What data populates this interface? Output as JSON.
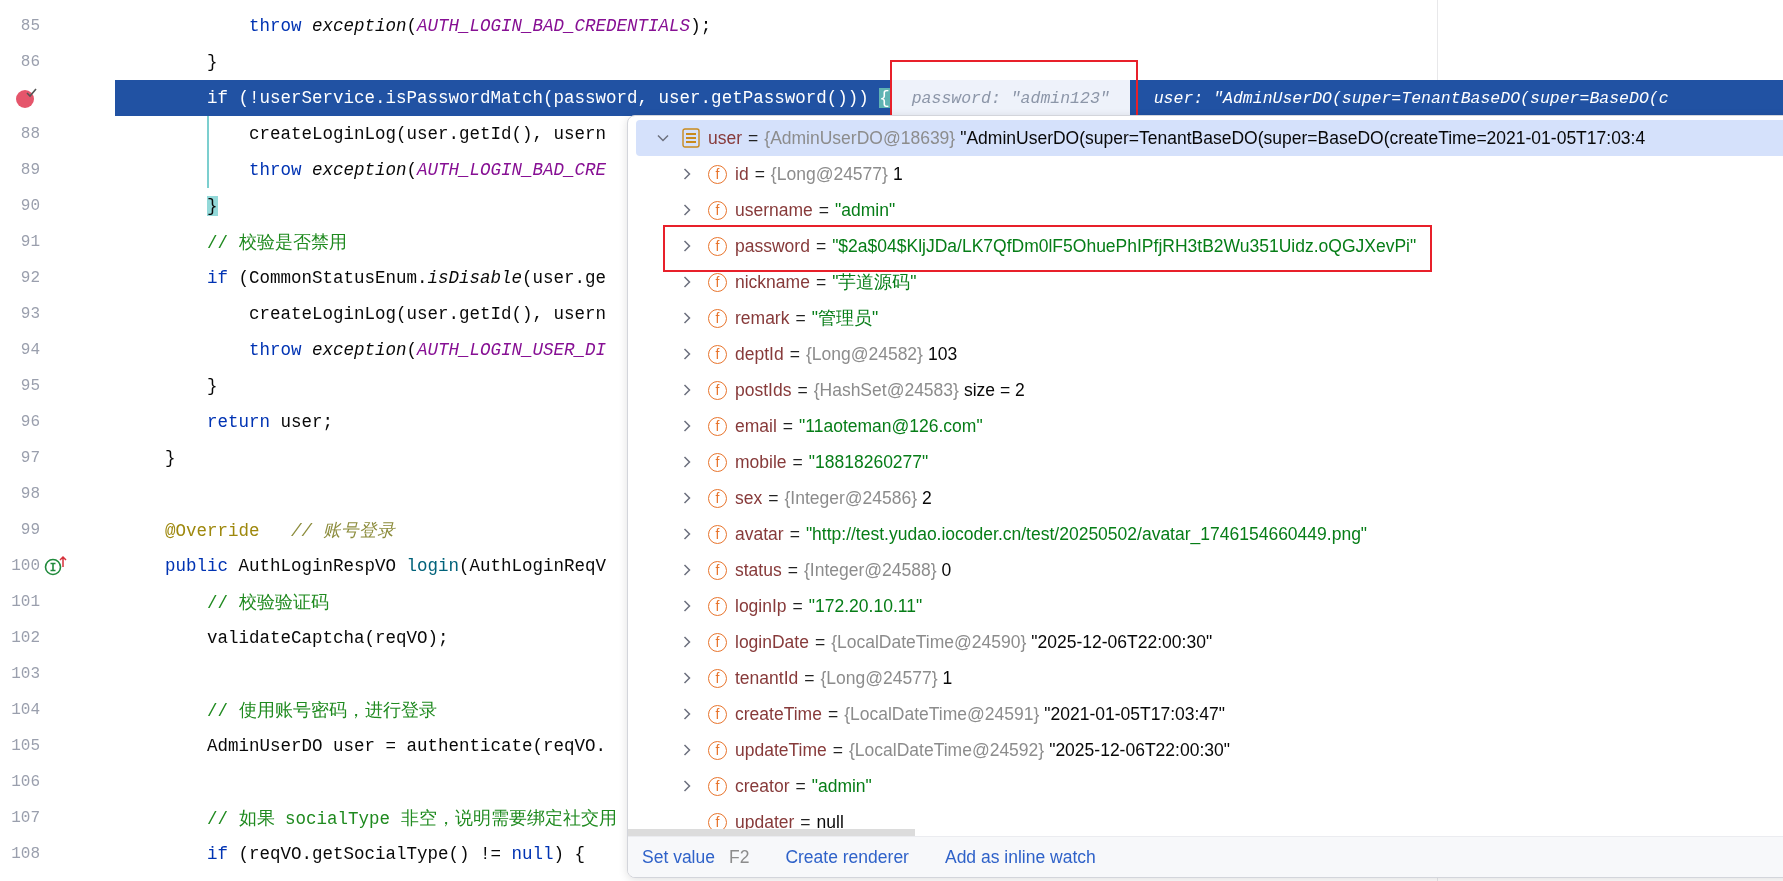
{
  "code_lines": [
    {
      "number": "85",
      "segments": [
        {
          "kind": "kw",
          "text": "            throw "
        },
        {
          "kind": "call",
          "text": "exception"
        },
        {
          "kind": "plain",
          "text": "("
        },
        {
          "kind": "const",
          "text": "AUTH_LOGIN_BAD_CREDENTIALS"
        },
        {
          "kind": "plain",
          "text": ");"
        }
      ]
    },
    {
      "number": "86",
      "segments": [
        {
          "kind": "plain",
          "text": "        }"
        }
      ]
    },
    {
      "gutter_icon": {
        "kind": "breakpoint"
      },
      "current": true,
      "segments": [
        {
          "kind": "kw",
          "text": "        if"
        },
        {
          "kind": "plain",
          "text": " (!userService.isPasswordMatch(password, user.getPassword())) "
        },
        {
          "kind": "match",
          "text": "{"
        }
      ],
      "hints": [
        {
          "kind": "param",
          "text": "password: \"admin123\"",
          "boxed": true
        },
        {
          "kind": "value",
          "text": "user: \"AdminUserDO(super=TenantBaseDO(super=BaseDO(c",
          "boxed": false
        }
      ]
    },
    {
      "number": "88",
      "guide": true,
      "segments": [
        {
          "kind": "plain",
          "text": "            createLoginLog(user.getId(), usern"
        }
      ]
    },
    {
      "number": "89",
      "guide": true,
      "segments": [
        {
          "kind": "kw",
          "text": "            throw "
        },
        {
          "kind": "call",
          "text": "exception"
        },
        {
          "kind": "plain",
          "text": "("
        },
        {
          "kind": "const",
          "text": "AUTH_LOGIN_BAD_CRE"
        }
      ]
    },
    {
      "number": "90",
      "segments": [
        {
          "kind": "match",
          "text": "        }"
        }
      ]
    },
    {
      "number": "91",
      "segments": [
        {
          "kind": "comment",
          "text": "        // 校验是否禁用"
        }
      ]
    },
    {
      "number": "92",
      "segments": [
        {
          "kind": "kw",
          "text": "        if"
        },
        {
          "kind": "plain",
          "text": " (CommonStatusEnum."
        },
        {
          "kind": "call",
          "text": "isDisable"
        },
        {
          "kind": "plain",
          "text": "(user.ge"
        }
      ]
    },
    {
      "number": "93",
      "segments": [
        {
          "kind": "plain",
          "text": "            createLoginLog(user.getId(), usern"
        }
      ]
    },
    {
      "number": "94",
      "segments": [
        {
          "kind": "kw",
          "text": "            throw "
        },
        {
          "kind": "call",
          "text": "exception"
        },
        {
          "kind": "plain",
          "text": "("
        },
        {
          "kind": "const",
          "text": "AUTH_LOGIN_USER_DI"
        }
      ]
    },
    {
      "number": "95",
      "segments": [
        {
          "kind": "plain",
          "text": "        }"
        }
      ]
    },
    {
      "number": "96",
      "segments": [
        {
          "kind": "kw",
          "text": "        return"
        },
        {
          "kind": "plain",
          "text": " user;"
        }
      ]
    },
    {
      "number": "97",
      "segments": [
        {
          "kind": "plain",
          "text": "    }"
        }
      ]
    },
    {
      "number": "98"
    },
    {
      "number": "99",
      "segments": [
        {
          "kind": "annot",
          "text": "    @Override   "
        },
        {
          "kind": "comment_italic",
          "text": "// 账号登录"
        }
      ]
    },
    {
      "number": "100",
      "gutter_icon": {
        "kind": "implements"
      },
      "segments": [
        {
          "kind": "kw",
          "text": "    public"
        },
        {
          "kind": "plain",
          "text": " AuthLoginRespVO "
        },
        {
          "kind": "decl",
          "text": "login"
        },
        {
          "kind": "plain",
          "text": "(AuthLoginReqV"
        }
      ]
    },
    {
      "number": "101",
      "segments": [
        {
          "kind": "comment",
          "text": "        // 校验验证码"
        }
      ]
    },
    {
      "number": "102",
      "segments": [
        {
          "kind": "plain",
          "text": "        validateCaptcha(reqVO);"
        }
      ]
    },
    {
      "number": "103"
    },
    {
      "number": "104",
      "segments": [
        {
          "kind": "comment",
          "text": "        // 使用账号密码，进行登录"
        }
      ]
    },
    {
      "number": "105",
      "segments": [
        {
          "kind": "plain",
          "text": "        AdminUserDO user = authenticate(reqVO."
        }
      ]
    },
    {
      "number": "106"
    },
    {
      "number": "107",
      "segments": [
        {
          "kind": "comment",
          "text": "        // 如果 socialType 非空，说明需要绑定社交用"
        }
      ]
    },
    {
      "number": "108",
      "segments": [
        {
          "kind": "kw",
          "text": "        if"
        },
        {
          "kind": "plain",
          "text": " (reqVO.getSocialType() != "
        },
        {
          "kind": "kw",
          "text": "null"
        },
        {
          "kind": "plain",
          "text": ") {"
        }
      ]
    }
  ],
  "debug_popup": {
    "root": {
      "name": "user",
      "sep": "=",
      "type": "{AdminUserDO@18639}",
      "value": {
        "kind": "plain",
        "text": "\"AdminUserDO(super=TenantBaseDO(super=BaseDO(createTime=2021-01-05T17:03:4"
      },
      "expanded": true,
      "selected": true,
      "children": [
        {
          "icon": "f",
          "name": "id",
          "sep": "=",
          "type": "{Long@24577}",
          "value": {
            "kind": "plain",
            "text": "1"
          },
          "expandable": true,
          "boxed": false
        },
        {
          "icon": "f",
          "name": "username",
          "sep": "=",
          "value": {
            "kind": "string",
            "text": "\"admin\""
          },
          "expandable": true,
          "boxed": false
        },
        {
          "icon": "f",
          "name": "password",
          "sep": "=",
          "value": {
            "kind": "string",
            "text": "\"$2a$04$KljJDa/LK7QfDm0lF5OhuePhIPfjRH3tB2Wu351Uidz.oQGJXevPi\""
          },
          "expandable": true,
          "boxed": true
        },
        {
          "icon": "f",
          "name": "nickname",
          "sep": "=",
          "value": {
            "kind": "string",
            "text": "\"芋道源码\""
          },
          "expandable": true,
          "boxed": false
        },
        {
          "icon": "f",
          "name": "remark",
          "sep": "=",
          "value": {
            "kind": "string",
            "text": "\"管理员\""
          },
          "expandable": true,
          "boxed": false
        },
        {
          "icon": "f",
          "name": "deptId",
          "sep": "=",
          "type": "{Long@24582}",
          "value": {
            "kind": "plain",
            "text": "103"
          },
          "expandable": true,
          "boxed": false
        },
        {
          "icon": "f",
          "name": "postIds",
          "sep": "=",
          "type": "{HashSet@24583}",
          "value": {
            "kind": "plain",
            "text": "size = 2"
          },
          "expandable": true,
          "boxed": false
        },
        {
          "icon": "f",
          "name": "email",
          "sep": "=",
          "value": {
            "kind": "string",
            "text": "\"11aoteman@126.com\""
          },
          "expandable": true,
          "boxed": false
        },
        {
          "icon": "f",
          "name": "mobile",
          "sep": "=",
          "value": {
            "kind": "string",
            "text": "\"18818260277\""
          },
          "expandable": true,
          "boxed": false
        },
        {
          "icon": "f",
          "name": "sex",
          "sep": "=",
          "type": "{Integer@24586}",
          "value": {
            "kind": "plain",
            "text": "2"
          },
          "expandable": true,
          "boxed": false
        },
        {
          "icon": "f",
          "name": "avatar",
          "sep": "=",
          "value": {
            "kind": "string",
            "text": "\"http://test.yudao.iocoder.cn/test/20250502/avatar_1746154660449.png\""
          },
          "expandable": true,
          "boxed": false
        },
        {
          "icon": "f",
          "name": "status",
          "sep": "=",
          "type": "{Integer@24588}",
          "value": {
            "kind": "plain",
            "text": "0"
          },
          "expandable": true,
          "boxed": false
        },
        {
          "icon": "f",
          "name": "loginIp",
          "sep": "=",
          "value": {
            "kind": "string",
            "text": "\"172.20.10.11\""
          },
          "expandable": true,
          "boxed": false
        },
        {
          "icon": "f",
          "name": "loginDate",
          "sep": "=",
          "type": "{LocalDateTime@24590}",
          "value": {
            "kind": "plain",
            "text": "\"2025-12-06T22:00:30\""
          },
          "expandable": true,
          "boxed": false
        },
        {
          "icon": "f",
          "name": "tenantId",
          "sep": "=",
          "type": "{Long@24577}",
          "value": {
            "kind": "plain",
            "text": "1"
          },
          "expandable": true,
          "boxed": false
        },
        {
          "icon": "f",
          "name": "createTime",
          "sep": "=",
          "type": "{LocalDateTime@24591}",
          "value": {
            "kind": "plain",
            "text": "\"2021-01-05T17:03:47\""
          },
          "expandable": true,
          "boxed": false
        },
        {
          "icon": "f",
          "name": "updateTime",
          "sep": "=",
          "type": "{LocalDateTime@24592}",
          "value": {
            "kind": "plain",
            "text": "\"2025-12-06T22:00:30\""
          },
          "expandable": true,
          "boxed": false
        },
        {
          "icon": "f",
          "name": "creator",
          "sep": "=",
          "value": {
            "kind": "string",
            "text": "\"admin\""
          },
          "expandable": true,
          "boxed": false
        },
        {
          "icon": "f",
          "name": "updater",
          "sep": "=",
          "value": {
            "kind": "plain",
            "text": "null"
          },
          "expandable": false,
          "boxed": false
        }
      ]
    },
    "actions": [
      {
        "label": "Set value",
        "shortcut": "F2"
      },
      {
        "label": "Create renderer"
      },
      {
        "label": "Add as inline watch"
      }
    ]
  }
}
